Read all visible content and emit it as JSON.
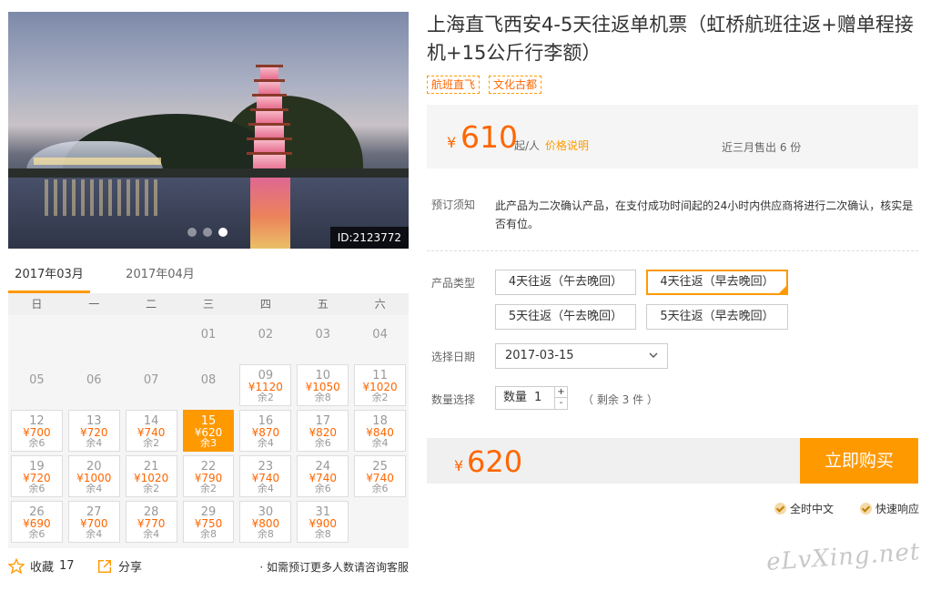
{
  "photo": {
    "id_label": "ID:2123772",
    "slides": 3,
    "active_slide": 3
  },
  "calendar": {
    "months": [
      "2017年03月",
      "2017年04月"
    ],
    "active_month": 0,
    "weekdays": [
      "日",
      "一",
      "二",
      "三",
      "四",
      "五",
      "六"
    ],
    "cells": [
      {
        "type": "blank"
      },
      {
        "type": "blank"
      },
      {
        "type": "blank"
      },
      {
        "type": "plain",
        "day": "01"
      },
      {
        "type": "plain",
        "day": "02"
      },
      {
        "type": "plain",
        "day": "03"
      },
      {
        "type": "plain",
        "day": "04"
      },
      {
        "type": "plain",
        "day": "05"
      },
      {
        "type": "plain",
        "day": "06"
      },
      {
        "type": "plain",
        "day": "07"
      },
      {
        "type": "plain",
        "day": "08"
      },
      {
        "type": "avail",
        "day": "09",
        "price": "¥1120",
        "stock": "余2"
      },
      {
        "type": "avail",
        "day": "10",
        "price": "¥1050",
        "stock": "余8"
      },
      {
        "type": "avail",
        "day": "11",
        "price": "¥1020",
        "stock": "余2"
      },
      {
        "type": "avail",
        "day": "12",
        "price": "¥700",
        "stock": "余6"
      },
      {
        "type": "avail",
        "day": "13",
        "price": "¥720",
        "stock": "余4"
      },
      {
        "type": "avail",
        "day": "14",
        "price": "¥740",
        "stock": "余2"
      },
      {
        "type": "avail",
        "day": "15",
        "price": "¥620",
        "stock": "余3",
        "selected": true
      },
      {
        "type": "avail",
        "day": "16",
        "price": "¥870",
        "stock": "余4"
      },
      {
        "type": "avail",
        "day": "17",
        "price": "¥820",
        "stock": "余6"
      },
      {
        "type": "avail",
        "day": "18",
        "price": "¥840",
        "stock": "余4"
      },
      {
        "type": "avail",
        "day": "19",
        "price": "¥720",
        "stock": "余6"
      },
      {
        "type": "avail",
        "day": "20",
        "price": "¥1000",
        "stock": "余4"
      },
      {
        "type": "avail",
        "day": "21",
        "price": "¥1020",
        "stock": "余2"
      },
      {
        "type": "avail",
        "day": "22",
        "price": "¥790",
        "stock": "余2"
      },
      {
        "type": "avail",
        "day": "23",
        "price": "¥740",
        "stock": "余4"
      },
      {
        "type": "avail",
        "day": "24",
        "price": "¥740",
        "stock": "余6"
      },
      {
        "type": "avail",
        "day": "25",
        "price": "¥740",
        "stock": "余6"
      },
      {
        "type": "avail",
        "day": "26",
        "price": "¥690",
        "stock": "余6"
      },
      {
        "type": "avail",
        "day": "27",
        "price": "¥700",
        "stock": "余4"
      },
      {
        "type": "avail",
        "day": "28",
        "price": "¥770",
        "stock": "余4"
      },
      {
        "type": "avail",
        "day": "29",
        "price": "¥750",
        "stock": "余8"
      },
      {
        "type": "avail",
        "day": "30",
        "price": "¥800",
        "stock": "余8"
      },
      {
        "type": "avail",
        "day": "31",
        "price": "¥900",
        "stock": "余8"
      }
    ]
  },
  "actions": {
    "favorite_label": "收藏",
    "favorite_count": "17",
    "share_label": "分享",
    "consult_text": "如需预订更多人数请咨询客服"
  },
  "product": {
    "title": "上海直飞西安4-5天往返单机票（虹桥航班往返+赠单程接机+15公斤行李额）",
    "tags": [
      "航班直飞",
      "文化古都"
    ],
    "price": {
      "currency": "¥",
      "amount": "610",
      "unit": "起/人",
      "explain_link": "价格说明",
      "sold_text": "近三月售出 6 份"
    },
    "notice": {
      "label": "预订须知",
      "text": "此产品为二次确认产品，在支付成功时间起的24小时内供应商将进行二次确认，核实是否有位。"
    },
    "product_type": {
      "label": "产品类型",
      "options": [
        "4天往返（午去晚回）",
        "4天往返（早去晚回）",
        "5天往返（午去晚回）",
        "5天往返（早去晚回）"
      ],
      "selected_index": 1
    },
    "date": {
      "label": "选择日期",
      "value": "2017-03-15"
    },
    "quantity": {
      "label": "数量选择",
      "prefix": "数量",
      "value": "1",
      "plus": "+",
      "minus": "-",
      "remaining": "（ 剩余 3 件 ）"
    },
    "total": {
      "currency": "¥",
      "amount": "620"
    },
    "buy_label": "立即购买",
    "guarantees": [
      "全时中文",
      "快速响应"
    ]
  },
  "watermark": "eLvXing.net",
  "colors": {
    "accent": "#ff9900",
    "price": "#ff6600"
  }
}
